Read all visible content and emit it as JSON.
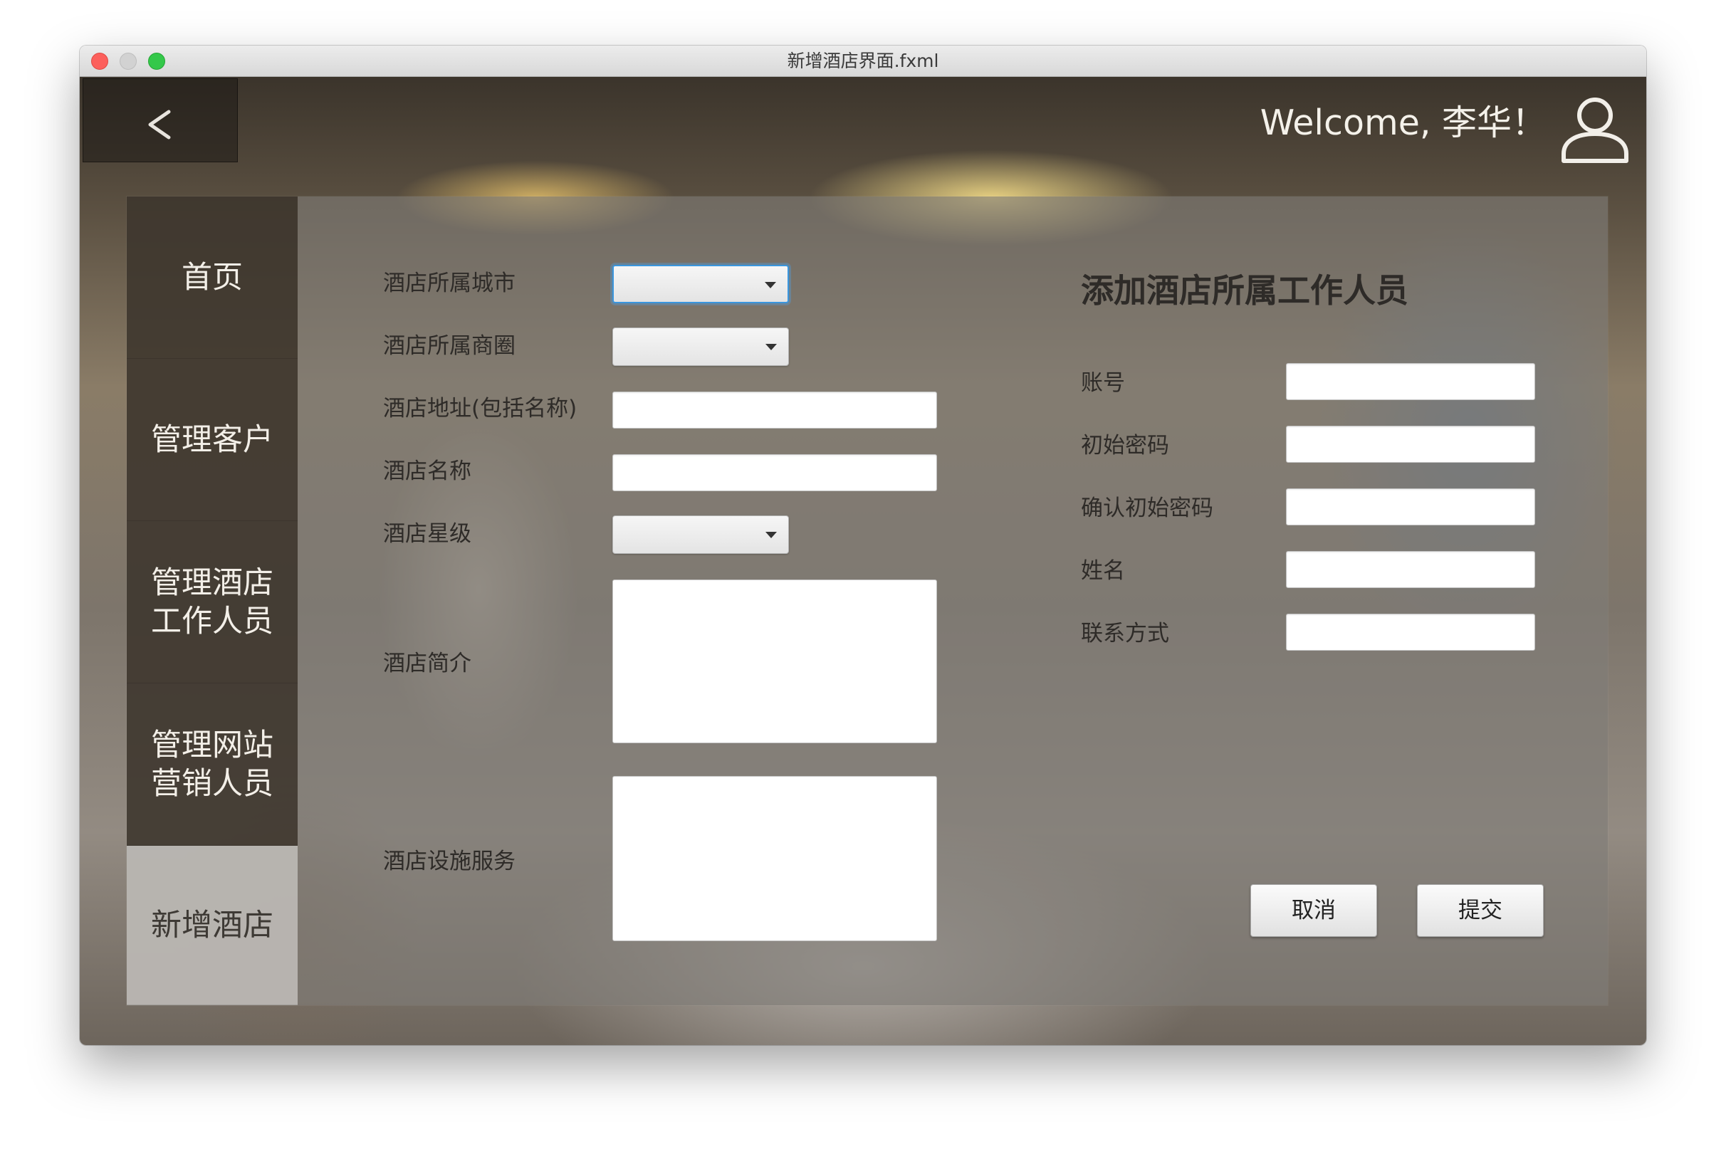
{
  "window": {
    "title": "新增酒店界面.fxml"
  },
  "header": {
    "back_glyph": "<",
    "welcome_text": "Welcome, 李华！",
    "user_icon": "user-icon"
  },
  "sidebar": {
    "items": [
      {
        "label": "首页",
        "active": false
      },
      {
        "label": "管理客户",
        "active": false
      },
      {
        "label": "管理酒店\n工作人员",
        "active": false
      },
      {
        "label": "管理网站\n营销人员",
        "active": false
      },
      {
        "label": "新增酒店",
        "active": true
      }
    ]
  },
  "hotel_form": {
    "city_label": "酒店所属城市",
    "city_value": "",
    "business_area_label": "酒店所属商圈",
    "business_area_value": "",
    "address_label": "酒店地址(包括名称)",
    "address_value": "",
    "name_label": "酒店名称",
    "name_value": "",
    "star_label": "酒店星级",
    "star_value": "",
    "intro_label": "酒店简介",
    "intro_value": "",
    "facilities_label": "酒店设施服务",
    "facilities_value": ""
  },
  "staff_form": {
    "title": "添加酒店所属工作人员",
    "account_label": "账号",
    "account_value": "",
    "password_label": "初始密码",
    "password_value": "",
    "confirm_password_label": "确认初始密码",
    "confirm_password_value": "",
    "name_label": "姓名",
    "name_value": "",
    "contact_label": "联系方式",
    "contact_value": ""
  },
  "actions": {
    "cancel_label": "取消",
    "submit_label": "提交"
  },
  "colors": {
    "focus_ring": "#3a96de",
    "active_tab_bg": "#bcb8b4",
    "sidebar_bg": "#2e261c"
  }
}
